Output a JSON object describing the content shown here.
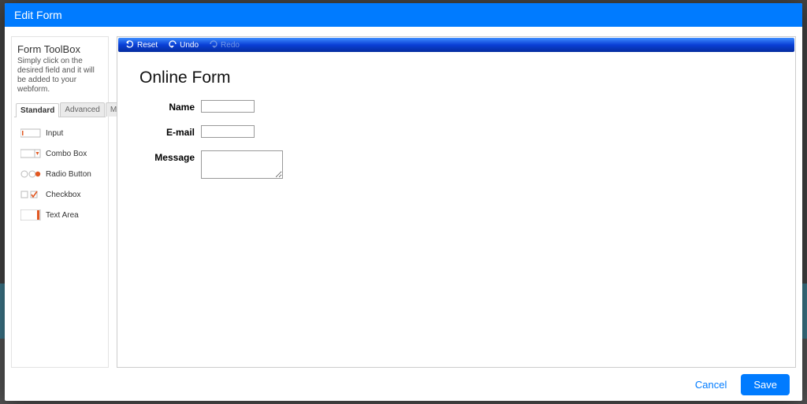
{
  "header": {
    "title": "Edit Form"
  },
  "sidebar": {
    "title": "Form ToolBox",
    "description": "Simply click on the desired field and it will be added to your webform.",
    "tabs": [
      {
        "label": "Standard",
        "active": true
      },
      {
        "label": "Advanced",
        "active": false
      },
      {
        "label": "Misc.",
        "active": false
      }
    ],
    "items": [
      {
        "label": "Input",
        "icon": "input-icon"
      },
      {
        "label": "Combo Box",
        "icon": "combobox-icon"
      },
      {
        "label": "Radio Button",
        "icon": "radio-icon"
      },
      {
        "label": "Checkbox",
        "icon": "checkbox-icon"
      },
      {
        "label": "Text Area",
        "icon": "textarea-icon"
      }
    ]
  },
  "editor": {
    "toolbar": {
      "reset": "Reset",
      "undo": "Undo",
      "redo": "Redo"
    },
    "form": {
      "title": "Online Form",
      "fields": [
        {
          "label": "Name",
          "type": "text",
          "value": ""
        },
        {
          "label": "E-mail",
          "type": "text",
          "value": ""
        },
        {
          "label": "Message",
          "type": "textarea",
          "value": ""
        }
      ]
    }
  },
  "footer": {
    "cancel": "Cancel",
    "save": "Save"
  },
  "colors": {
    "primary": "#007bff",
    "toolbar_gradient_top": "#3d8dff",
    "toolbar_gradient_bottom": "#052c9e",
    "icon_accent": "#e25822"
  }
}
